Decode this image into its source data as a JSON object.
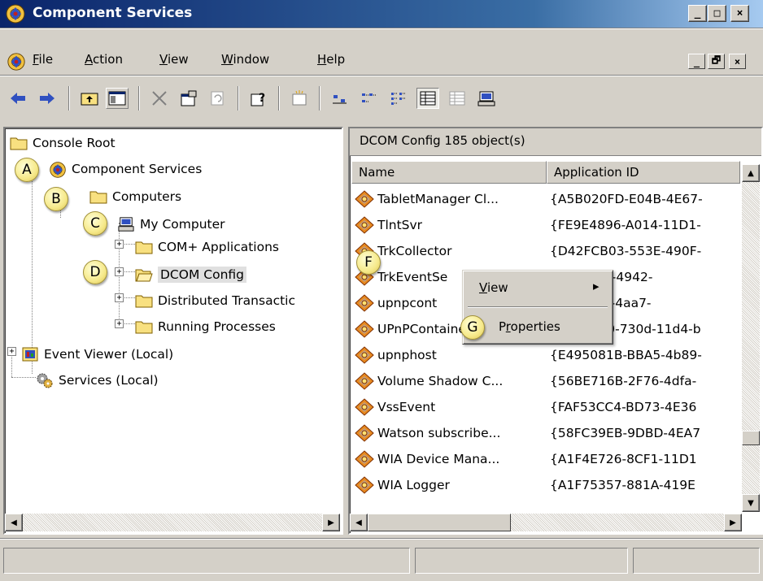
{
  "window": {
    "title": "Component Services",
    "caption_buttons": [
      "_",
      "□",
      "×"
    ],
    "mdi_buttons": [
      "_",
      "🗗",
      "×"
    ]
  },
  "menu": {
    "items": [
      {
        "label": "File",
        "underline": "F",
        "rest": "ile"
      },
      {
        "label": "Action",
        "underline": "A",
        "rest": "ction"
      },
      {
        "label": "View",
        "underline": "V",
        "rest": "iew"
      },
      {
        "label": "Window",
        "underline": "W",
        "rest": "indow"
      },
      {
        "label": "Help",
        "underline": "H",
        "rest": "elp"
      }
    ]
  },
  "toolbar": {
    "icons": [
      "back-arrow-icon",
      "forward-arrow-icon",
      "up-folder-icon",
      "show-hide-tree-icon",
      "delete-icon",
      "properties-icon",
      "refresh-icon",
      "help-icon",
      "new-window-icon",
      "large-icons-icon",
      "small-icons-icon",
      "list-view-icon",
      "detail-view-icon",
      "status-view-icon",
      "computer-icon"
    ]
  },
  "tree": {
    "items": [
      {
        "label": "Console Root",
        "icon": "folder-icon"
      },
      {
        "label": "Component Services",
        "icon": "component-services-icon",
        "callout": "A"
      },
      {
        "label": "Computers",
        "icon": "folder-icon",
        "callout": "B"
      },
      {
        "label": "My Computer",
        "icon": "computer-icon",
        "callout": "C"
      },
      {
        "label": "COM+ Applications",
        "icon": "folder-icon",
        "expander": "+"
      },
      {
        "label": "DCOM Config",
        "icon": "open-folder-icon",
        "expander": "+",
        "callout": "D",
        "selected": true
      },
      {
        "label": "Distributed Transactic",
        "icon": "folder-icon",
        "expander": "+"
      },
      {
        "label": "Running Processes",
        "icon": "folder-icon",
        "expander": "+"
      },
      {
        "label": "Event Viewer (Local)",
        "icon": "event-viewer-icon",
        "expander": "+"
      },
      {
        "label": "Services (Local)",
        "icon": "services-gear-icon"
      }
    ]
  },
  "list": {
    "header": "DCOM Config   185 object(s)",
    "columns": [
      "Name",
      "Application ID"
    ],
    "rows": [
      {
        "name": "TabletManager Cl...",
        "id": "{A5B020FD-E04B-4E67-"
      },
      {
        "name": "TlntSvr",
        "id": "{FE9E4896-A014-11D1-"
      },
      {
        "name": "TrkCollector",
        "id": "{D42FCB03-553E-490F-",
        "callout": "F"
      },
      {
        "name": "TrkEventSe",
        "id": "90B-886A-4942-"
      },
      {
        "name": "upnpcont",
        "id": "159-5804-4aa7-"
      },
      {
        "name": "UPnPContainer",
        "id": "(d8df7de0-730d-11d4-b"
      },
      {
        "name": "upnphost",
        "id": "{E495081B-BBA5-4b89-"
      },
      {
        "name": "Volume Shadow C...",
        "id": "{56BE716B-2F76-4dfa-"
      },
      {
        "name": "VssEvent",
        "id": "{FAF53CC4-BD73-4E36"
      },
      {
        "name": "Watson subscribe...",
        "id": "{58FC39EB-9DBD-4EA7"
      },
      {
        "name": "WIA Device Mana...",
        "id": "{A1F4E726-8CF1-11D1"
      },
      {
        "name": "WIA Logger",
        "id": "{A1F75357-881A-419E"
      }
    ]
  },
  "context_menu": {
    "items": [
      {
        "label": "View",
        "underline": "V",
        "rest": "iew",
        "submenu_arrow": "▸"
      },
      {
        "label": "Properties",
        "underline": "r",
        "pre": "P",
        "rest": "operties",
        "callout": "G"
      }
    ]
  },
  "callouts": [
    "A",
    "B",
    "C",
    "D",
    "F",
    "G"
  ],
  "colors": {
    "title_gradient_start": "#0a246a",
    "title_gradient_end": "#a6caf0",
    "chrome": "#d4d0c8",
    "callout_fill": "#f6e98a"
  }
}
